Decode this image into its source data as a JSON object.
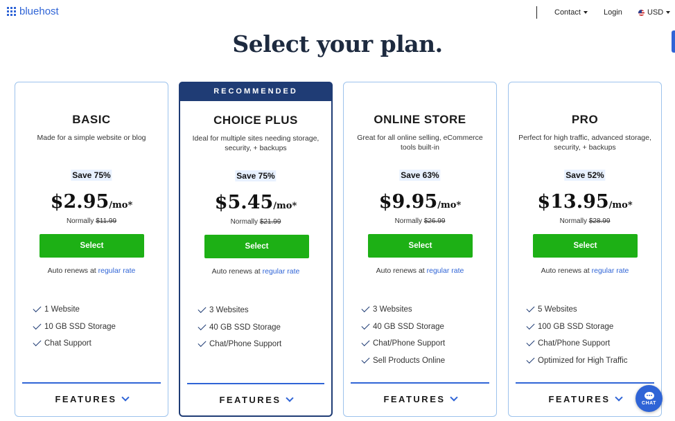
{
  "header": {
    "logo_text": "bluehost",
    "nav": {
      "contact": "Contact",
      "login": "Login",
      "currency": "USD"
    }
  },
  "page_title": "Select your plan.",
  "plans": [
    {
      "name": "BASIC",
      "description": "Made for a simple website or blog",
      "save": "Save 75%",
      "price": "$2.95",
      "per": "/mo*",
      "normally_label": "Normally",
      "normally_price": "$11.99",
      "select_label": "Select",
      "renews_text": "Auto renews at",
      "renews_link": "regular rate",
      "features": [
        "1 Website",
        "10 GB SSD Storage",
        "Chat Support"
      ],
      "features_label": "FEATURES"
    },
    {
      "banner": "RECOMMENDED",
      "name": "CHOICE PLUS",
      "description": "Ideal for multiple sites needing storage, security, + backups",
      "save": "Save 75%",
      "price": "$5.45",
      "per": "/mo*",
      "normally_label": "Normally",
      "normally_price": "$21.99",
      "select_label": "Select",
      "renews_text": "Auto renews at",
      "renews_link": "regular rate",
      "features": [
        "3 Websites",
        "40 GB SSD Storage",
        "Chat/Phone Support"
      ],
      "features_label": "FEATURES"
    },
    {
      "name": "ONLINE STORE",
      "description": "Great for all online selling, eCommerce tools built-in",
      "save": "Save 63%",
      "price": "$9.95",
      "per": "/mo*",
      "normally_label": "Normally",
      "normally_price": "$26.99",
      "select_label": "Select",
      "renews_text": "Auto renews at",
      "renews_link": "regular rate",
      "features": [
        "3 Websites",
        "40 GB SSD Storage",
        "Chat/Phone Support",
        "Sell Products Online"
      ],
      "features_label": "FEATURES"
    },
    {
      "name": "PRO",
      "description": "Perfect for high traffic, advanced storage, security, + backups",
      "save": "Save 52%",
      "price": "$13.95",
      "per": "/mo*",
      "normally_label": "Normally",
      "normally_price": "$28.99",
      "select_label": "Select",
      "renews_text": "Auto renews at",
      "renews_link": "regular rate",
      "features": [
        "5 Websites",
        "100 GB SSD Storage",
        "Chat/Phone Support",
        "Optimized for High Traffic"
      ],
      "features_label": "FEATURES"
    }
  ],
  "chat": {
    "label": "CHAT"
  },
  "colors": {
    "brand_blue": "#2f64d6",
    "navy": "#1f3c75",
    "select_green": "#1db015"
  }
}
